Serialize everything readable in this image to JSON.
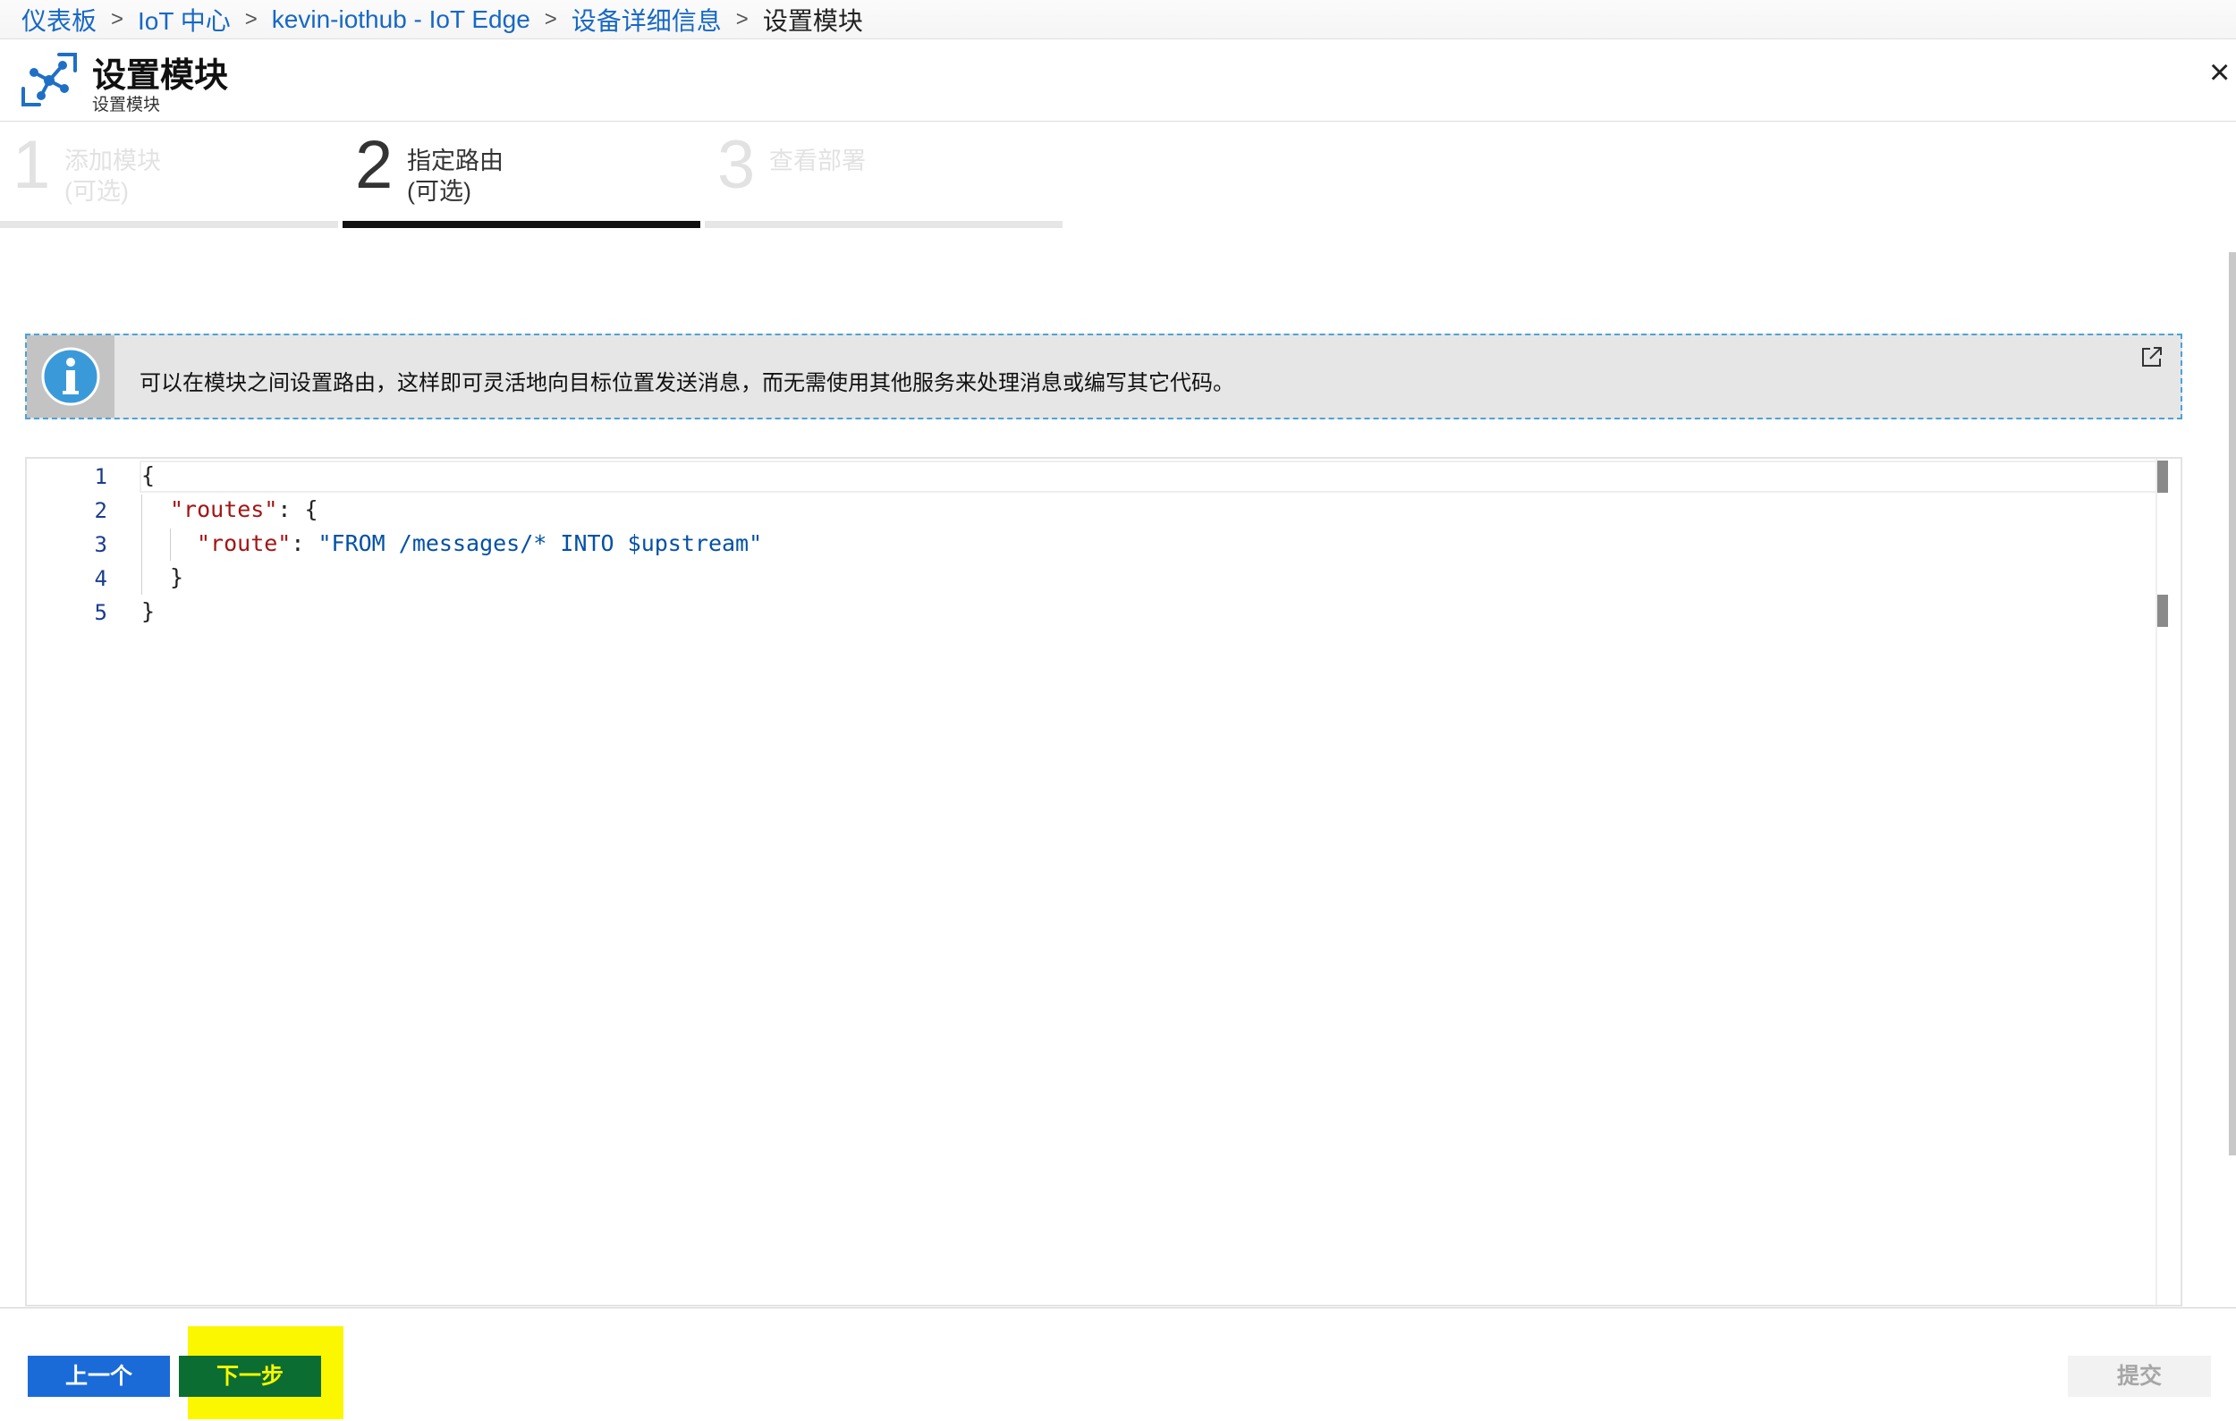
{
  "breadcrumb": {
    "items": [
      "仪表板",
      "IoT 中心",
      "kevin-iothub - IoT Edge",
      "设备详细信息"
    ],
    "current": "设置模块",
    "separator": ">"
  },
  "blade": {
    "title": "设置模块",
    "subtitle": "设置模块",
    "close": "×"
  },
  "steps": [
    {
      "number": "1",
      "line1": "添加模块",
      "line2": "(可选)"
    },
    {
      "number": "2",
      "line1": "指定路由",
      "line2": "(可选)"
    },
    {
      "number": "3",
      "line1": "查看部署",
      "line2": ""
    }
  ],
  "info": {
    "text": "可以在模块之间设置路由，这样即可灵活地向目标位置发送消息，而无需使用其他服务来处理消息或编写其它代码。"
  },
  "editor": {
    "line_numbers": [
      "1",
      "2",
      "3",
      "4",
      "5"
    ],
    "lines": {
      "l1": "{",
      "l2_key": "\"routes\"",
      "l2_rest": ": {",
      "l3_key": "\"route\"",
      "l3_colon": ": ",
      "l3_val": "\"FROM /messages/* INTO $upstream\"",
      "l4": "}",
      "l5": "}"
    }
  },
  "footer": {
    "prev_label": "上一个",
    "next_label": "下一步",
    "submit_label": "提交"
  },
  "colors": {
    "link": "#1768c4",
    "accent_blue": "#1a6bd8",
    "next_bg": "#0b6d32",
    "highlight": "#fbf700",
    "info_border": "#4aa3d7"
  },
  "icons": {
    "blade": "module-network-icon",
    "info": "info-icon",
    "external": "external-link-icon",
    "close": "close-icon"
  }
}
